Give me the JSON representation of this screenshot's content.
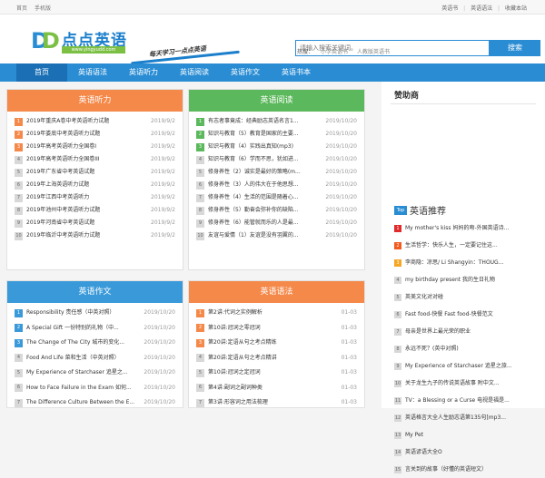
{
  "topbar": {
    "home": "首页",
    "mobile": "手机版",
    "links": [
      "英语书",
      "英语语法",
      "收藏本站"
    ]
  },
  "logo": {
    "mark": "DD",
    "name": "点点英语",
    "url": "www.yingyudd.com",
    "slogan": "每天学习一点点英语"
  },
  "search": {
    "placeholder": "请输入搜索关键词。",
    "button": "搜索",
    "hot_label": "热搜：",
    "hot": [
      "小学英语书",
      "人教版英语书"
    ]
  },
  "nav": [
    "首页",
    "英语语法",
    "英语听力",
    "英语阅读",
    "英语作文",
    "英语书本"
  ],
  "listening": {
    "title": "英语听力",
    "items": [
      {
        "n": "1",
        "t": "2019年重庆A卷中考英语听力试题",
        "d": "2019/9/2"
      },
      {
        "n": "2",
        "t": "2019年娄底中考英语听力试题",
        "d": "2019/9/2"
      },
      {
        "n": "3",
        "t": "2019年高考英语听力全国卷I",
        "d": "2019/9/2"
      },
      {
        "n": "4",
        "t": "2019年高考英语听力全国卷III",
        "d": "2019/9/2"
      },
      {
        "n": "5",
        "t": "2019年广东省中考英语试题",
        "d": "2019/9/2"
      },
      {
        "n": "6",
        "t": "2019年上海英语听力试题",
        "d": "2019/9/2"
      },
      {
        "n": "7",
        "t": "2019年江西中考英语听力",
        "d": "2019/9/2"
      },
      {
        "n": "8",
        "t": "2019年池州中考英语听力试题",
        "d": "2019/9/2"
      },
      {
        "n": "9",
        "t": "2019年河南省中考英语试题",
        "d": "2019/9/2"
      },
      {
        "n": "10",
        "t": "2019年临沂中考英语听力试题",
        "d": "2019/9/2"
      }
    ]
  },
  "reading": {
    "title": "英语阅读",
    "items": [
      {
        "n": "1",
        "t": "有志者事竟成：经典励志英语名言1...",
        "d": "2019/10/20"
      },
      {
        "n": "2",
        "t": "知识与教育（5）教育是国家的主要...",
        "d": "2019/10/20"
      },
      {
        "n": "3",
        "t": "知识与教育（4）实践出真知(mp3)",
        "d": "2019/10/20"
      },
      {
        "n": "4",
        "t": "知识与教育（6）学而不思，犹如进...",
        "d": "2019/10/20"
      },
      {
        "n": "5",
        "t": "修身养性（2）诚实是最好的策略(m...",
        "d": "2019/10/20"
      },
      {
        "n": "6",
        "t": "修身养性（3）人的伟大在于他思想...",
        "d": "2019/10/20"
      },
      {
        "n": "7",
        "t": "修身养性（4）生活的范围是随着心...",
        "d": "2019/10/20"
      },
      {
        "n": "8",
        "t": "修身养性（5）勤奋会弥补你的缺陷...",
        "d": "2019/10/20"
      },
      {
        "n": "9",
        "t": "修身养性（6）能管就而乐的人是最...",
        "d": "2019/10/20"
      },
      {
        "n": "10",
        "t": "友谊与爱情（1）友谊是没有羽翼的...",
        "d": "2019/10/20"
      }
    ]
  },
  "writing": {
    "title": "英语作文",
    "items": [
      {
        "n": "1",
        "t": "Responsibility 责任感（中英对照）",
        "d": "2019/10/20"
      },
      {
        "n": "2",
        "t": "A Special Gift 一份特别的礼物（中...",
        "d": "2019/10/20"
      },
      {
        "n": "3",
        "t": "The Change of The City 城市的变化...",
        "d": "2019/10/20"
      },
      {
        "n": "4",
        "t": "Food And Life 菜和生活（中英对照）",
        "d": "2019/10/20"
      },
      {
        "n": "5",
        "t": "My Experience of Starchaser 追星之...",
        "d": "2019/10/20"
      },
      {
        "n": "6",
        "t": "How to Face Failure in the Exam 如何...",
        "d": "2019/10/20"
      },
      {
        "n": "7",
        "t": "The Difference Culture Between the E...",
        "d": "2019/10/20"
      }
    ]
  },
  "grammar": {
    "title": "英语语法",
    "items": [
      {
        "n": "1",
        "t": "第2讲:代词之实例解析",
        "d": "01-03"
      },
      {
        "n": "2",
        "t": "第10讲:冠词之零冠词",
        "d": "01-03"
      },
      {
        "n": "3",
        "t": "第20讲:定语从句之考点精练",
        "d": "01-03"
      },
      {
        "n": "4",
        "t": "第20讲:定语从句之考点精讲",
        "d": "01-03"
      },
      {
        "n": "5",
        "t": "第10讲:冠词之定冠词",
        "d": "01-03"
      },
      {
        "n": "6",
        "t": "第4讲:副词之副词种类",
        "d": "01-03"
      },
      {
        "n": "7",
        "t": "第3讲:形容词之用法梳理",
        "d": "01-03"
      }
    ]
  },
  "side": {
    "sponsor": "赞助商",
    "rec_badge": "Top",
    "rec_title": "英语推荐",
    "items": [
      {
        "n": "1",
        "t": "My mother's kiss 妈妈的吻-外国英语诗..."
      },
      {
        "n": "2",
        "t": "生活哲学：快乐人生，一定要记住这..."
      },
      {
        "n": "3",
        "t": "李商隐：凉思/ Li Shangyin：THOUG..."
      },
      {
        "n": "4",
        "t": "my birthday present 我的生日礼物"
      },
      {
        "n": "5",
        "t": "英美文化对对碰"
      },
      {
        "n": "6",
        "t": "Fast food-快餐 Fast food-快餐范文"
      },
      {
        "n": "7",
        "t": "母亲是世界上最光荣的职业"
      },
      {
        "n": "8",
        "t": "永远不死？(英中对照)"
      },
      {
        "n": "9",
        "t": "My Experience of Starchaser 追星之旅..."
      },
      {
        "n": "10",
        "t": "关于龙生九子的传说英语故事 附中文..."
      },
      {
        "n": "11",
        "t": "TV：a Blessing or a Curse 电视是福是..."
      },
      {
        "n": "12",
        "t": "英语格言大全人生励志语第135句[mp3..."
      },
      {
        "n": "13",
        "t": "My Pet"
      },
      {
        "n": "14",
        "t": "英语谚语大全O"
      },
      {
        "n": "15",
        "t": "言关到的故事（好懂的英语短文）"
      }
    ]
  },
  "colors": {
    "brand_blue": "#2a8dd4",
    "orange": "#f5894a",
    "green": "#5cb85c",
    "blue": "#3a9ad9"
  }
}
